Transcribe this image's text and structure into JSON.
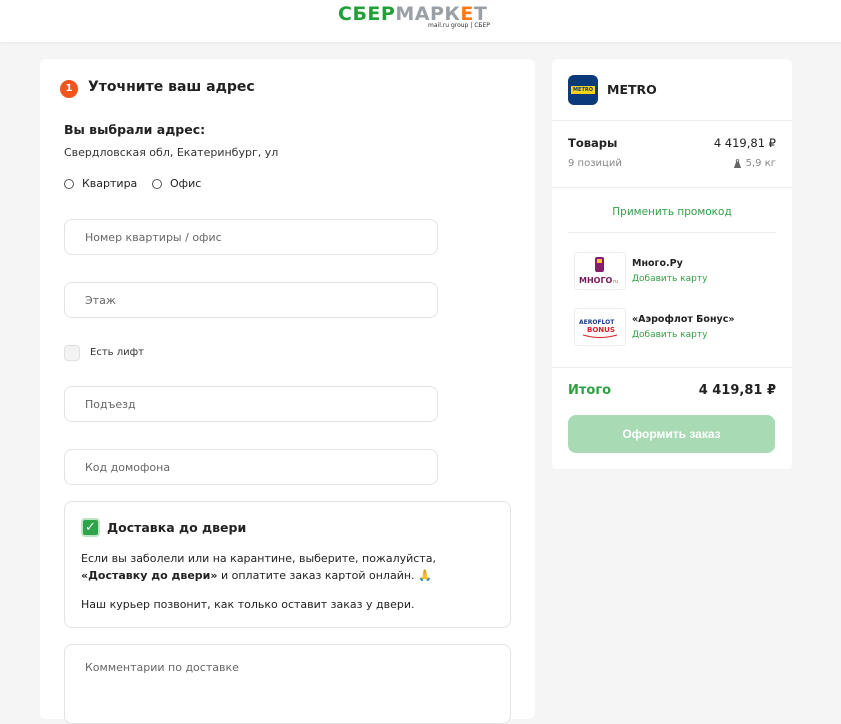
{
  "header": {
    "logo_sber": "СБЕР",
    "logo_market": "МАРК",
    "logo_mark": "Е",
    "logo_t": "Т",
    "logo_sub": "mail.ru group | СБЕР"
  },
  "address_form": {
    "step_number": "1",
    "title": "Уточните ваш адрес",
    "chosen_label": "Вы выбрали адрес:",
    "chosen_value": "Свердловская обл, Екатеринбург, ул",
    "radio_apartment": "Квартира",
    "radio_office": "Офис",
    "apartment_placeholder": "Номер квартиры / офис",
    "floor_placeholder": "Этаж",
    "elevator_label": "Есть лифт",
    "entrance_placeholder": "Подъезд",
    "intercom_placeholder": "Код домофона",
    "door_delivery": {
      "title": "Доставка до двери",
      "text_part1": "Если вы заболели или на карантине, выберите, пожалуйста, ",
      "text_bold": "«Доставку до двери»",
      "text_part2": " и оплатите заказ картой онлайн. 🙏",
      "courier_text": "Наш курьер позвонит, как только оставит заказ у двери."
    },
    "comment_placeholder": "Комментарии по доставке"
  },
  "summary": {
    "store_name": "METRO",
    "store_logo_text": "METRO",
    "goods_label": "Товары",
    "goods_total": "4 419,81 ₽",
    "goods_count": "9 позиций",
    "goods_weight": "5,9 кг",
    "promo_link": "Применить промокод",
    "loyalty": [
      {
        "name": "Много.Ру",
        "action": "Добавить карту",
        "logo_text": "МНОГО.ru"
      },
      {
        "name": "«Аэрофлот Бонус»",
        "action": "Добавить карту",
        "logo_text": "AEROFLOT BONUS"
      }
    ],
    "total_label": "Итого",
    "total_value": "4 419,81 ₽",
    "order_button": "Оформить заказ"
  },
  "colors": {
    "brand_green": "#21a038",
    "accent_orange": "#f2541b",
    "button_disabled": "#a8dbb4"
  }
}
